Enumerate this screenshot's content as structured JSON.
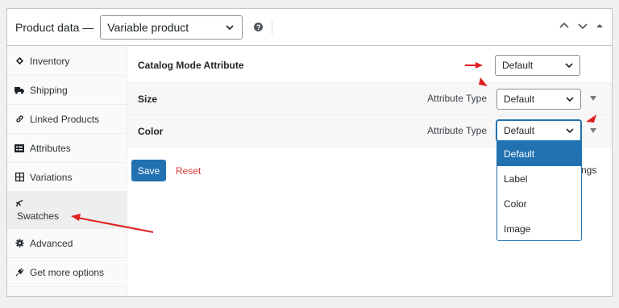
{
  "header": {
    "title": "Product data —",
    "product_type": "Variable product"
  },
  "sidebar": {
    "items": [
      {
        "label": "Inventory",
        "icon": "diamond-icon"
      },
      {
        "label": "Shipping",
        "icon": "truck-icon"
      },
      {
        "label": "Linked Products",
        "icon": "link-icon"
      },
      {
        "label": "Attributes",
        "icon": "list-icon"
      },
      {
        "label": "Variations",
        "icon": "grid-icon"
      },
      {
        "label": "Swatches",
        "icon": "swatches-icon"
      },
      {
        "label": "Advanced",
        "icon": "gear-icon"
      },
      {
        "label": "Get more options",
        "icon": "plugin-icon"
      }
    ]
  },
  "rows": {
    "catalog": {
      "name": "Catalog Mode Attribute",
      "value": "Default"
    },
    "size": {
      "name": "Size",
      "attr_label": "Attribute Type",
      "value": "Default"
    },
    "color": {
      "name": "Color",
      "attr_label": "Attribute Type",
      "value": "Default"
    }
  },
  "dropdown": {
    "options": [
      "Default",
      "Label",
      "Color",
      "Image"
    ],
    "selected": "Default"
  },
  "actions": {
    "save": "Save",
    "reset": "Reset",
    "partial_text": "ngs"
  },
  "colors": {
    "accent": "#2271b1",
    "reset": "#d63638",
    "annotation": "#e0201f"
  }
}
